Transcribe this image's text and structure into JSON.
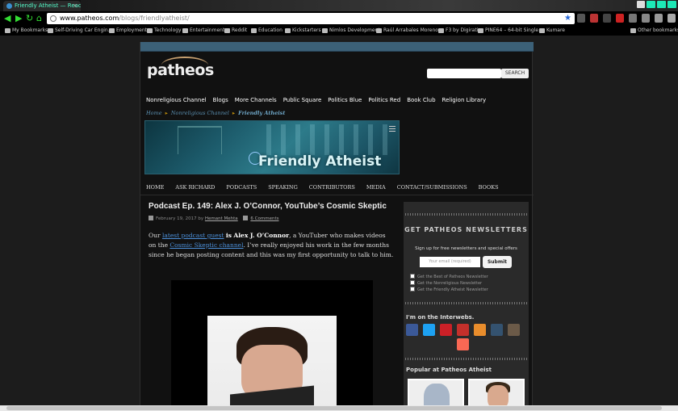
{
  "browser": {
    "tab_title": "Friendly Atheist — Read…",
    "tab_close": "×",
    "nav_icons": [
      "back-icon",
      "forward-icon",
      "reload-icon",
      "home-icon"
    ],
    "url_domain": "www.patheos.com",
    "url_path": "/blogs/friendlyatheist/",
    "bookmarks": [
      "My Bookmarks",
      "Self-Driving Car Engin…",
      "Employment",
      "Technology",
      "Entertainment",
      "Reddit",
      "Education",
      "Kickstarters",
      "Nimlos Development",
      "Raúl Arrabales Moreno",
      "F3 by Digirati",
      "PINE64 – 64-bit Single…",
      "Kumare"
    ],
    "other_bookmarks": "Other bookmarks"
  },
  "site": {
    "logo": "patheos",
    "search_button": "SEARCH",
    "main_nav": [
      "Nonreligious Channel",
      "Blogs",
      "More Channels",
      "Public Square",
      "Politics Blue",
      "Politics Red",
      "Book Club",
      "Religion Library"
    ],
    "breadcrumb": {
      "home": "Home",
      "channel": "Nonreligious Channel",
      "current": "Friendly Atheist"
    },
    "banner_title": "Friendly Atheist",
    "section_nav": [
      "HOME",
      "ASK RICHARD",
      "PODCASTS",
      "SPEAKING",
      "CONTRIBUTORS",
      "MEDIA",
      "CONTACT/SUBMISSIONS",
      "BOOKS"
    ]
  },
  "article": {
    "title": "Podcast Ep. 149: Alex J. O’Connor, YouTube’s Cosmic Skeptic",
    "date": "February 19, 2017",
    "by": "by",
    "author": "Hemant Mehta",
    "comments": "6 Comments",
    "p_our": "Our",
    "p_link1": "latest podcast guest",
    "p_is": "is",
    "p_name": "Alex J. O’Connor",
    "p_mid": ", a YouTuber who makes videos on the",
    "p_link2": "Cosmic Skeptic channel",
    "p_end": ". I’ve really enjoyed his work in the few months since he began posting content and this was my first opportunity to talk to him."
  },
  "sidebar": {
    "nl_title": "GET PATHEOS NEWSLETTERS",
    "nl_sub": "Sign up for free newsletters and special offers",
    "email_placeholder": "Your email (required)",
    "submit": "Submit",
    "checks": [
      "Get the Best of Patheos Newsletter",
      "Get the Nonreligious Newsletter",
      "Get the Friendly Atheist Newsletter"
    ],
    "interwebs": "I'm on the Interwebs.",
    "social_icons": [
      "facebook-icon",
      "twitter-icon",
      "pinterest-icon",
      "youtube-icon",
      "rss-icon",
      "tumblr-icon",
      "instagram-icon",
      "patreon-icon"
    ],
    "social_colors": [
      "#3b5998",
      "#1da1f2",
      "#cb2027",
      "#c4302b",
      "#e98d2c",
      "#34526f",
      "#6b5a48",
      "#f96854"
    ],
    "popular": "Popular at Patheos Atheist"
  }
}
